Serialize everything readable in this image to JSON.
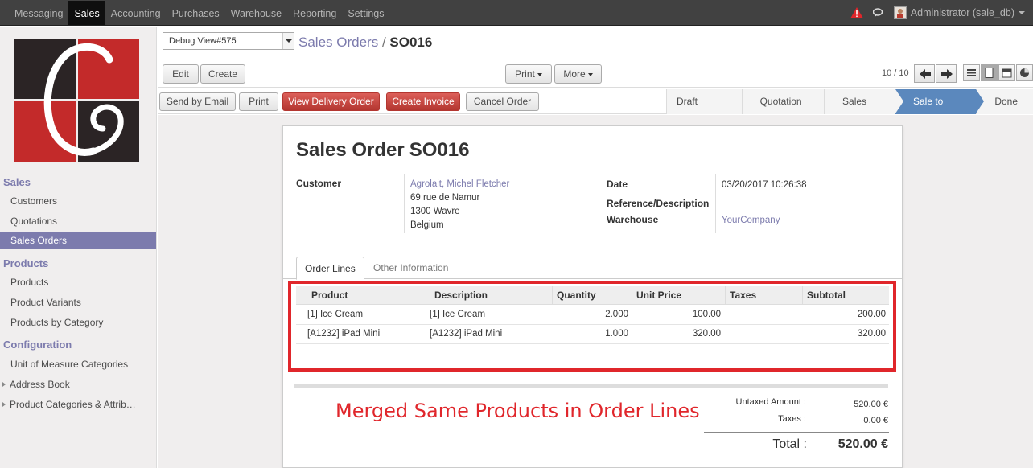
{
  "topbar": {
    "menu": [
      "Messaging",
      "Sales",
      "Accounting",
      "Purchases",
      "Warehouse",
      "Reporting",
      "Settings"
    ],
    "active": "Sales",
    "user": "Administrator (sale_db)"
  },
  "sidebar": {
    "sections": [
      {
        "title": "Sales",
        "items": [
          "Customers",
          "Quotations",
          "Sales Orders"
        ]
      },
      {
        "title": "Products",
        "items": [
          "Products",
          "Product Variants",
          "Products by Category"
        ]
      },
      {
        "title": "Configuration",
        "items": [
          "Unit of Measure Categories",
          "Address Book",
          "Product Categories & Attrib…"
        ]
      }
    ],
    "active_item": "Sales Orders"
  },
  "control": {
    "debug_select": "Debug View#575",
    "breadcrumb_parent": "Sales Orders",
    "breadcrumb_sep": "/",
    "breadcrumb_current": "SO016",
    "edit_label": "Edit",
    "create_label": "Create",
    "print_label": "Print",
    "more_label": "More",
    "pager": "10 / 10"
  },
  "header": {
    "buttons": [
      "Send by Email",
      "Print",
      "View Delivery Order",
      "Create Invoice",
      "Cancel Order"
    ],
    "stages": [
      "Draft Quotation",
      "Quotation Sent",
      "Sales Order",
      "Sale to Invoice",
      "Done"
    ],
    "active_stage": "Sale to Invoice",
    "colors": {
      "primary_button": "#c23e38",
      "active_stage": "#5b88bd",
      "accent": "#7c7bad",
      "highlight_frame": "#e0262b"
    }
  },
  "form": {
    "title_prefix": "Sales Order",
    "title_number": "SO016",
    "customer_label": "Customer",
    "customer_name": "Agrolait, Michel Fletcher",
    "customer_address": [
      "69 rue de Namur",
      "1300 Wavre",
      "Belgium"
    ],
    "date_label": "Date",
    "date_value": "03/20/2017 10:26:38",
    "reference_label": "Reference/Description",
    "warehouse_label": "Warehouse",
    "warehouse_value": "YourCompany",
    "tabs": [
      "Order Lines",
      "Other Information"
    ],
    "active_tab": "Order Lines"
  },
  "order_lines": {
    "columns": [
      "Product",
      "Description",
      "Quantity",
      "Unit Price",
      "Taxes",
      "Subtotal"
    ],
    "rows": [
      {
        "product": "[1] Ice Cream",
        "description": "[1] Ice Cream",
        "quantity": "2.000",
        "unit_price": "100.00",
        "taxes": "",
        "subtotal": "200.00"
      },
      {
        "product": "[A1232] iPad Mini",
        "description": "[A1232] iPad Mini",
        "quantity": "1.000",
        "unit_price": "320.00",
        "taxes": "",
        "subtotal": "320.00"
      }
    ]
  },
  "annotation": "Merged Same Products in Order Lines",
  "totals": {
    "untaxed_label": "Untaxed Amount :",
    "untaxed_value": "520.00 €",
    "taxes_label": "Taxes :",
    "taxes_value": "0.00 €",
    "total_label": "Total :",
    "total_value": "520.00 €"
  }
}
